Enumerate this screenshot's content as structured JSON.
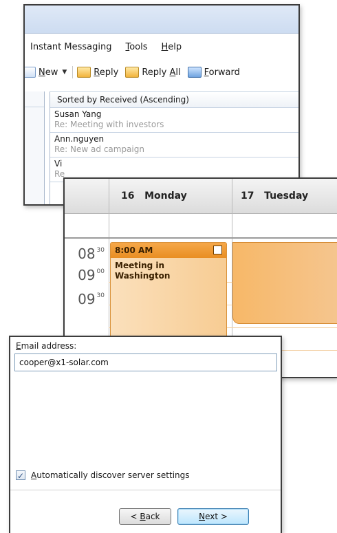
{
  "mail": {
    "menu": [
      {
        "pre": "Ins",
        "accel": "",
        "post": "tant Messaging"
      },
      {
        "pre": "",
        "accel": "T",
        "post": "ools"
      },
      {
        "pre": "",
        "accel": "H",
        "post": "elp"
      }
    ],
    "toolbar": {
      "new_accel": "N",
      "new_rest": "ew",
      "reply_accel": "R",
      "reply_rest": "eply",
      "reply_all_pre": "Reply ",
      "reply_all_accel": "A",
      "reply_all_rest": "ll",
      "forward_accel": "F",
      "forward_rest": "orward"
    },
    "sort_header": "Sorted by Received (Ascending)",
    "messages": [
      {
        "from": "Susan Yang",
        "subject": "Re: Meeting with investors"
      },
      {
        "from": "Ann.nguyen",
        "subject": "Re: New ad campaign"
      },
      {
        "from": "Vi",
        "subject": "Re"
      }
    ]
  },
  "calendar": {
    "days": [
      {
        "num": "16",
        "name": "Monday"
      },
      {
        "num": "17",
        "name": "Tuesday"
      }
    ],
    "times": [
      {
        "hour": "08",
        "min": "30"
      },
      {
        "hour": "09",
        "min": "00"
      },
      {
        "hour": "09",
        "min": "30"
      }
    ],
    "appointment": {
      "time": "8:00 AM",
      "title_line1": "Meeting in",
      "title_line2": "Washington"
    },
    "colors": {
      "appointment": "#f7cc93",
      "appointment_header": "#e98e22"
    }
  },
  "setup": {
    "email_label_accel": "E",
    "email_label_rest": "mail address:",
    "email_value": "cooper@x1-solar.com",
    "auto_discover_accel": "A",
    "auto_discover_rest": "utomatically discover server settings",
    "auto_discover_checked": true,
    "check_mark": "✓",
    "back_pre": "< ",
    "back_accel": "B",
    "back_rest": "ack",
    "next_accel": "N",
    "next_rest": "ext >"
  }
}
